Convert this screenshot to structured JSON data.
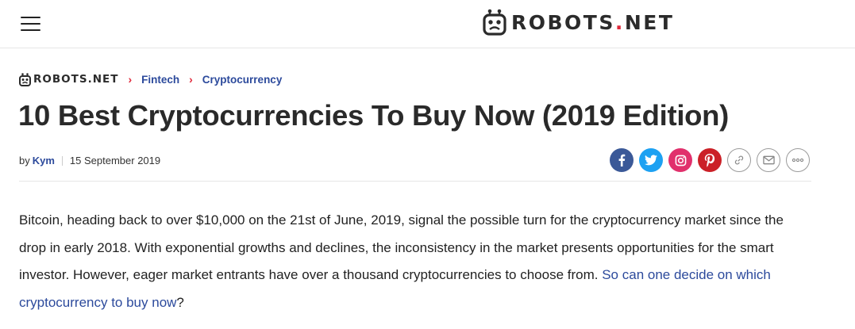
{
  "header": {
    "logo": {
      "word": "ROBOTS",
      "dot": ".",
      "tld": "NET"
    }
  },
  "breadcrumb": {
    "home": "ROBOTS.NET",
    "items": [
      "Fintech",
      "Cryptocurrency"
    ]
  },
  "article": {
    "title": "10 Best Cryptocurrencies To Buy Now (2019 Edition)",
    "by_label": "by",
    "author": "Kym",
    "date": "15 September 2019",
    "intro": "Bitcoin, heading back to over $10,000 on the 21st of June, 2019, signal the possible turn for the cryptocurrency market since the drop in early 2018. With exponential growths and declines, the inconsistency in the market presents opportunities for the smart investor. However, eager market entrants have over a thousand cryptocurrencies to choose from. ",
    "link_text": "So can one decide on which cryptocurrency to buy now",
    "trailing": "?"
  },
  "share": {
    "buttons": [
      {
        "name": "facebook-icon",
        "glyph": "f",
        "color": "#3b5998"
      },
      {
        "name": "twitter-icon",
        "glyph": "",
        "color": "#1da1f2"
      },
      {
        "name": "instagram-icon",
        "glyph": "",
        "color": "#e1306c"
      },
      {
        "name": "pinterest-icon",
        "glyph": "P",
        "color": "#cb2027"
      },
      {
        "name": "link-icon",
        "glyph": "",
        "color": "#9a9a9a"
      },
      {
        "name": "email-icon",
        "glyph": "",
        "color": "#9a9a9a"
      },
      {
        "name": "more-icon",
        "glyph": "...",
        "color": "#9a9a9a"
      }
    ]
  },
  "colors": {
    "accent_red": "#e0293b",
    "link_blue": "#2c4a9c"
  }
}
